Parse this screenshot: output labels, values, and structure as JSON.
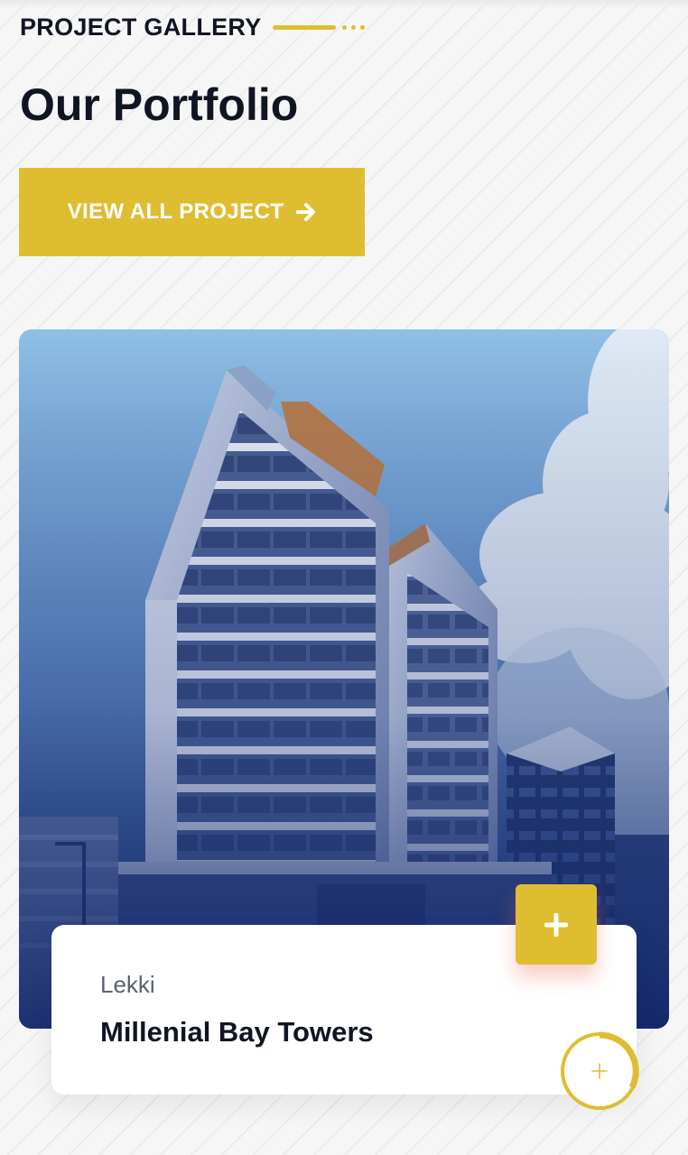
{
  "header": {
    "subtitle": "PROJECT GALLERY",
    "title": "Our Portfolio"
  },
  "cta": {
    "label": "VIEW ALL PROJECT",
    "icon": "arrow-right-icon"
  },
  "project": {
    "location": "Lekki",
    "title": "Millenial Bay Towers",
    "image": "building-photo",
    "expand_icon": "plus-icon",
    "circle_icon": "plus-thin-icon"
  },
  "colors": {
    "accent": "#dfbd31",
    "heading": "#101522",
    "muted": "#59626f",
    "overlay_blue": "#1c3577"
  }
}
